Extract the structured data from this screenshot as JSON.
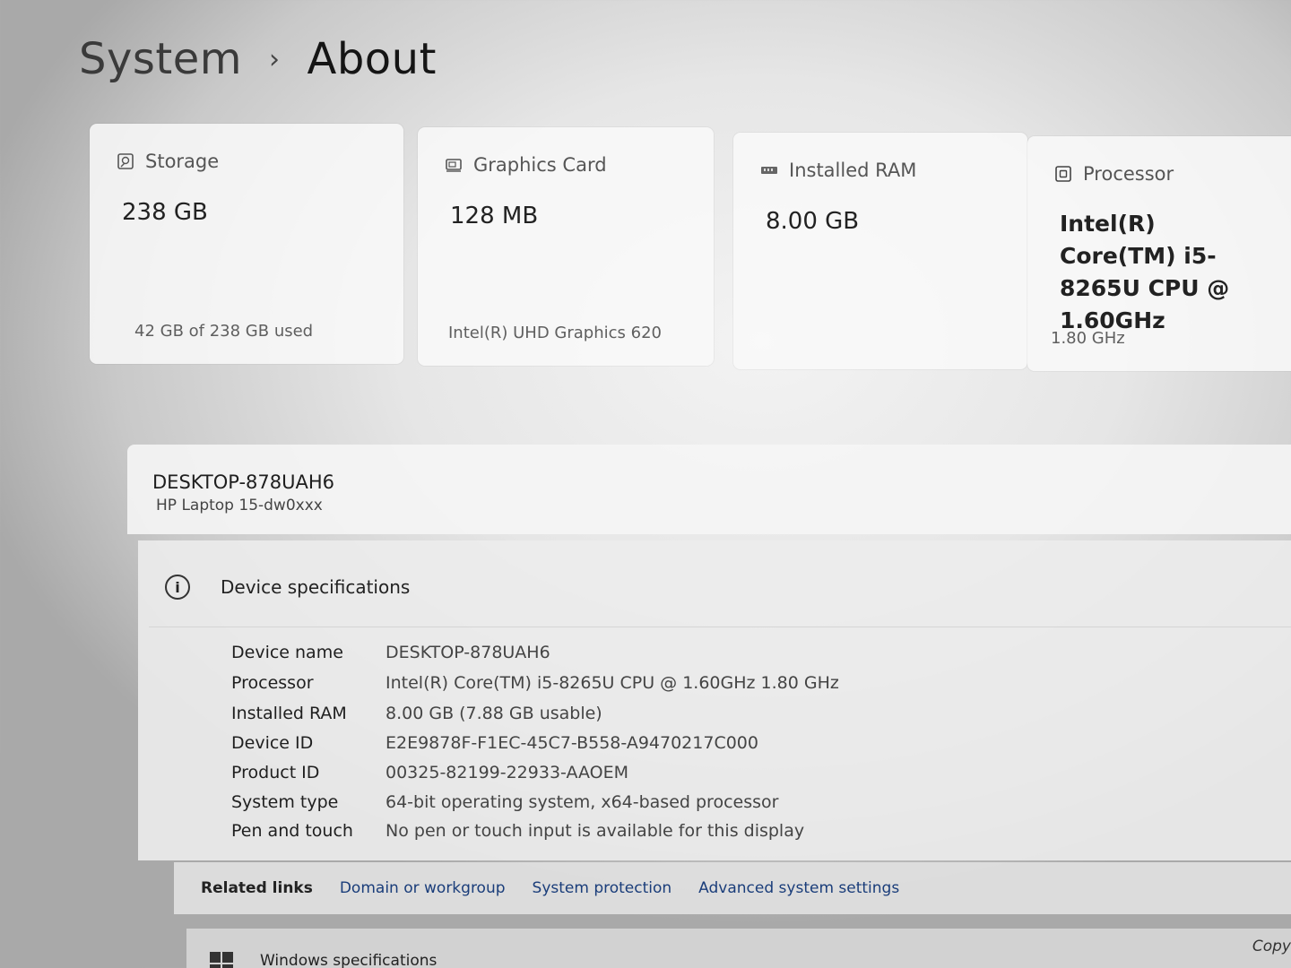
{
  "breadcrumb": {
    "parent": "System",
    "separator": "›",
    "current": "About"
  },
  "cards": {
    "storage": {
      "icon": "storage-icon",
      "title": "Storage",
      "value": "238 GB",
      "sub": "42 GB of 238 GB used"
    },
    "gpu": {
      "icon": "graphics-card-icon",
      "title": "Graphics Card",
      "value": "128 MB",
      "sub": "Intel(R) UHD Graphics 620"
    },
    "ram": {
      "icon": "ram-icon",
      "title": "Installed RAM",
      "value": "8.00 GB"
    },
    "cpu": {
      "icon": "processor-icon",
      "title": "Processor",
      "value": "Intel(R) Core(TM) i5-8265U CPU @ 1.60GHz",
      "sub": "1.80 GHz"
    }
  },
  "device": {
    "hostname": "DESKTOP-878UAH6",
    "model": "HP Laptop 15-dw0xxx"
  },
  "specs": {
    "title": "Device specifications",
    "rows": [
      {
        "key": "Device name",
        "value": "DESKTOP-878UAH6"
      },
      {
        "key": "Processor",
        "value": "Intel(R) Core(TM) i5-8265U CPU @ 1.60GHz   1.80 GHz"
      },
      {
        "key": "Installed RAM",
        "value": "8.00 GB (7.88 GB usable)"
      },
      {
        "key": "Device ID",
        "value": "E2E9878F-F1EC-45C7-B558-A9470217C000"
      },
      {
        "key": "Product ID",
        "value": "00325-82199-22933-AAOEM"
      },
      {
        "key": "System type",
        "value": "64-bit operating system, x64-based processor"
      },
      {
        "key": "Pen and touch",
        "value": "No pen or touch input is available for this display"
      }
    ]
  },
  "related": {
    "label": "Related links",
    "links": [
      "Domain or workgroup",
      "System protection",
      "Advanced system settings"
    ]
  },
  "windows_specs": {
    "title": "Windows specifications",
    "copy_label": "Copy"
  }
}
